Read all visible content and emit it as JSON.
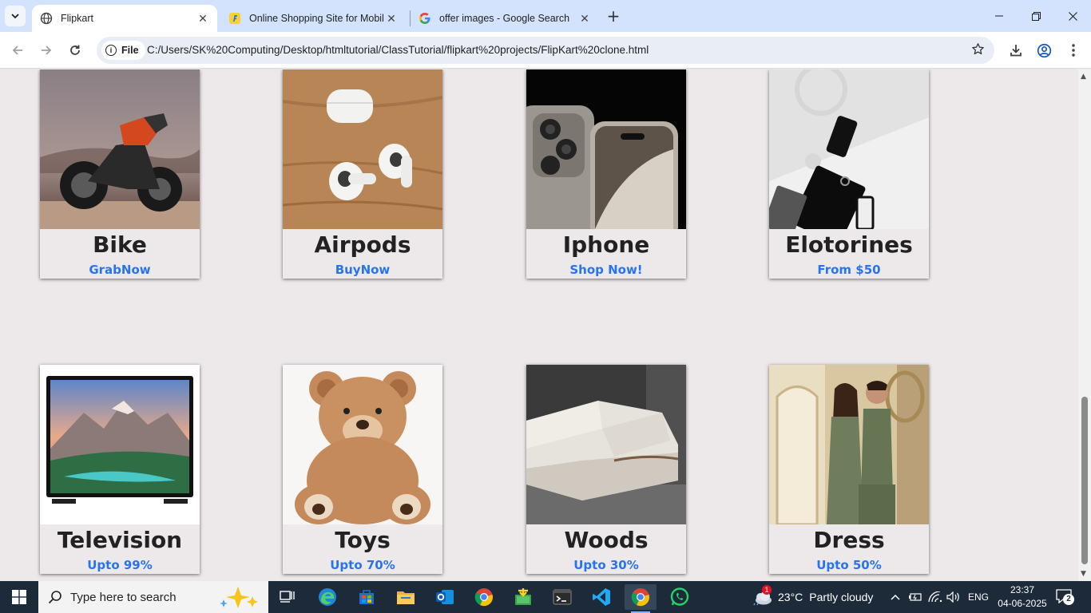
{
  "browser": {
    "tabs": [
      {
        "title": "Flipkart",
        "active": true
      },
      {
        "title": "Online Shopping Site for Mobile",
        "active": false
      },
      {
        "title": "offer images - Google Search",
        "active": false
      }
    ],
    "site_chip": "File",
    "url": "C:/Users/SK%20Computing/Desktop/htmltutorial/ClassTutorial/flipkart%20projects/FlipKart%20clone.html"
  },
  "products": [
    {
      "name": "Bike",
      "offer": "GrabNow",
      "image": "motorcycle-photo"
    },
    {
      "name": "Airpods",
      "offer": "BuyNow",
      "image": "airpods-photo"
    },
    {
      "name": "Iphone",
      "offer": "Shop Now!",
      "image": "iphone-photo"
    },
    {
      "name": "Elotorines",
      "offer": "From $50",
      "image": "electronics-photo"
    },
    {
      "name": "Television",
      "offer": "Upto 99%",
      "image": "television-photo"
    },
    {
      "name": "Toys",
      "offer": "Upto 70%",
      "image": "teddy-bear-photo"
    },
    {
      "name": "Woods",
      "offer": "Upto 30%",
      "image": "sofa-photo"
    },
    {
      "name": "Dress",
      "offer": "Upto 50%",
      "image": "couple-dress-photo"
    }
  ],
  "colors": {
    "offer": "#2874f0",
    "page_bg": "#ede9ea",
    "tabstrip": "#d3e3fd",
    "taskbar": "#1c2a3a"
  },
  "taskbar": {
    "search_placeholder": "Type here to search",
    "weather_temp": "23°C",
    "weather_text": "Partly cloudy",
    "weather_badge": "1",
    "language": "ENG",
    "time": "23:37",
    "date": "04-06-2025",
    "notifications": "2"
  }
}
